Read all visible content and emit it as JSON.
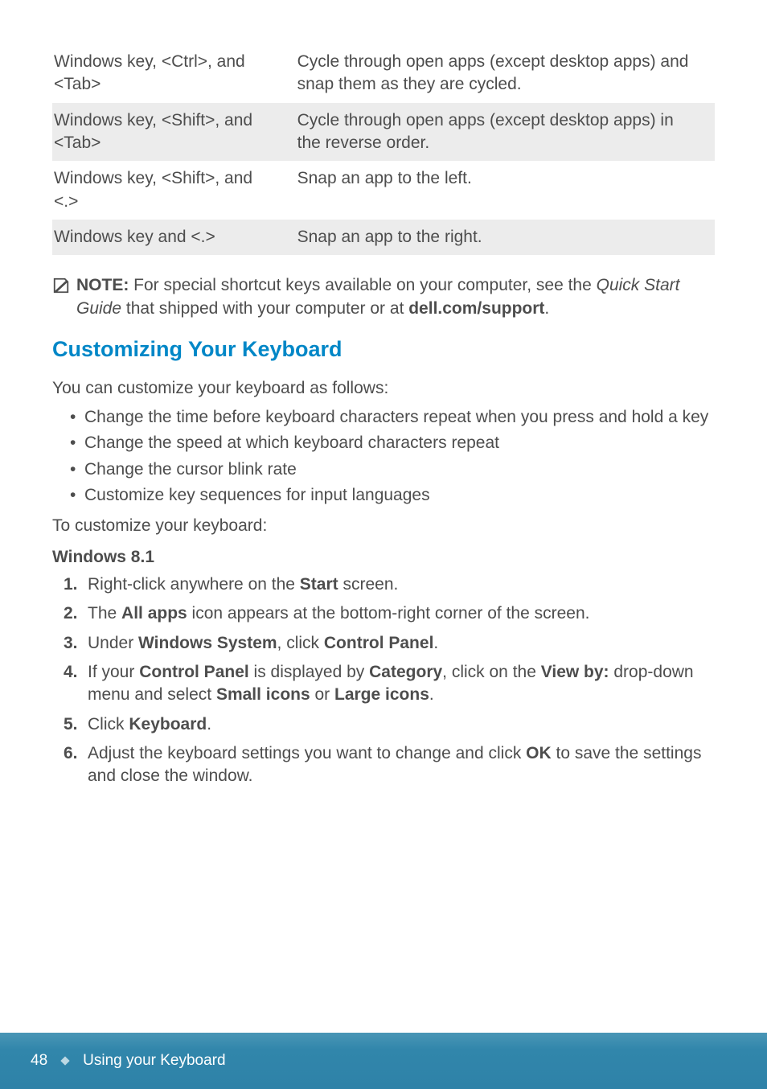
{
  "table": {
    "rows": [
      {
        "key": "Windows key, <Ctrl>, and <Tab>",
        "desc": "Cycle through open apps (except desktop apps) and snap them as they are cycled.",
        "shaded": false
      },
      {
        "key": "Windows key, <Shift>, and <Tab>",
        "desc": "Cycle through open apps (except desktop apps) in the reverse order.",
        "shaded": true
      },
      {
        "key": "Windows key, <Shift>, and <.>",
        "desc": "Snap an app to the left.",
        "shaded": false
      },
      {
        "key": "Windows key and <.>",
        "desc": "Snap an app to the right.",
        "shaded": true
      }
    ]
  },
  "note": {
    "label": "NOTE:",
    "text_before_italic": " For special shortcut keys available on your computer, see the ",
    "italic": "Quick Start Guide",
    "text_after_italic": " that shipped with your computer or at ",
    "bold_link": "dell.com/support",
    "text_end": "."
  },
  "heading": "Customizing Your Keyboard",
  "intro": "You can customize your keyboard as follows:",
  "bullets": [
    "Change the time before keyboard characters repeat when you press and hold a key",
    "Change the speed at which keyboard characters repeat",
    "Change the cursor blink rate",
    "Customize key sequences for input languages"
  ],
  "customize_lead": "To customize your keyboard:",
  "subheading": "Windows 8.1",
  "steps": [
    {
      "n": "1.",
      "parts": [
        {
          "t": "Right-click anywhere on the "
        },
        {
          "b": "Start"
        },
        {
          "t": " screen."
        }
      ]
    },
    {
      "n": "2.",
      "parts": [
        {
          "t": "The "
        },
        {
          "b": "All apps"
        },
        {
          "t": " icon appears at the bottom-right corner of the screen."
        }
      ]
    },
    {
      "n": "3.",
      "parts": [
        {
          "t": "Under "
        },
        {
          "b": "Windows System"
        },
        {
          "t": ", click "
        },
        {
          "b": "Control Panel"
        },
        {
          "t": "."
        }
      ]
    },
    {
      "n": "4.",
      "parts": [
        {
          "t": "If your "
        },
        {
          "b": "Control Panel"
        },
        {
          "t": " is displayed by "
        },
        {
          "b": "Category"
        },
        {
          "t": ", click on the "
        },
        {
          "b": "View by:"
        },
        {
          "t": " drop-down menu and select "
        },
        {
          "b": "Small icons"
        },
        {
          "t": " or "
        },
        {
          "b": "Large icons"
        },
        {
          "t": "."
        }
      ]
    },
    {
      "n": "5.",
      "parts": [
        {
          "t": "Click "
        },
        {
          "b": "Keyboard"
        },
        {
          "t": "."
        }
      ]
    },
    {
      "n": "6.",
      "parts": [
        {
          "t": "Adjust the keyboard settings you want to change and click "
        },
        {
          "b": "OK"
        },
        {
          "t": " to save the settings and close the window."
        }
      ]
    }
  ],
  "footer": {
    "page": "48",
    "title": "Using your Keyboard"
  }
}
